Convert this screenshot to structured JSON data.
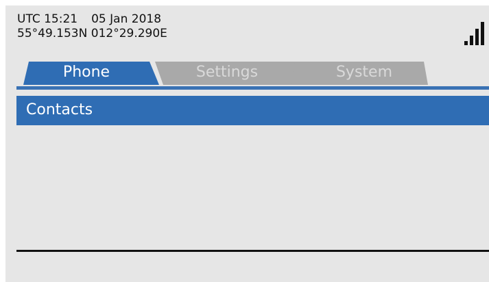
{
  "status": {
    "time": "UTC 15:21",
    "date": "05 Jan 2018",
    "latitude": "55°49.153N",
    "longitude": "012°29.290E",
    "signal_level": 4
  },
  "tabs": [
    {
      "label": "Phone",
      "active": true
    },
    {
      "label": "Settings",
      "active": false
    },
    {
      "label": "System",
      "active": false
    }
  ],
  "section": {
    "title": "Contacts"
  },
  "colors": {
    "accent": "#2f6db4",
    "background": "#e6e6e6",
    "inactive_tab": "#a9a9a9"
  },
  "icons": {
    "signal": "signal-strength-icon"
  }
}
